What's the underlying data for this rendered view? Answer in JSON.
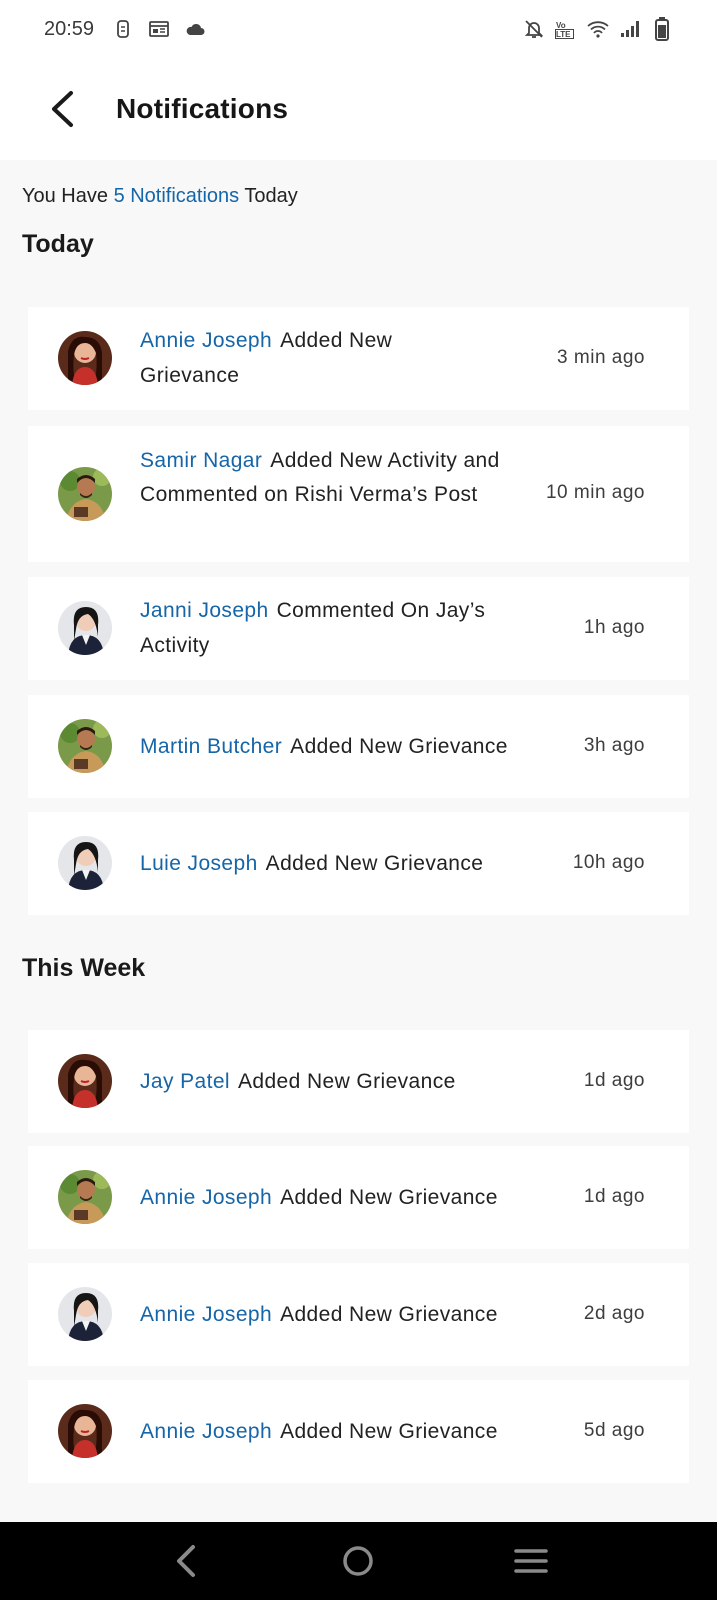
{
  "status_bar": {
    "time": "20:59",
    "icons_left": [
      "sim-icon",
      "calendar-icon",
      "cloud-icon"
    ],
    "icons_right": [
      "bell-off-icon",
      "volte-icon",
      "wifi-icon",
      "signal-icon",
      "battery-icon"
    ],
    "volte_label": "Vo LTE"
  },
  "header": {
    "title": "Notifications"
  },
  "summary": {
    "prefix": "You Have ",
    "count_text": "5 Notifications",
    "suffix": " Today"
  },
  "sections": {
    "today": {
      "title": "Today",
      "items": [
        {
          "name": "Annie Joseph",
          "action": "Added New Grievance",
          "time": "3 min ago",
          "avatar": "red"
        },
        {
          "name": "Samir Nagar",
          "action": "Added New Activity and Commented on Rishi Verma’s Post",
          "time": "10 min ago",
          "avatar": "green"
        },
        {
          "name": "Janni Joseph",
          "action": "Commented On Jay’s Activity",
          "time": "1h ago",
          "avatar": "navy"
        },
        {
          "name": "Martin Butcher",
          "action": "Added New Grievance",
          "time": "3h ago",
          "avatar": "green"
        },
        {
          "name": "Luie Joseph",
          "action": "Added New Grievance",
          "time": "10h ago",
          "avatar": "navy"
        }
      ]
    },
    "this_week": {
      "title": "This Week",
      "items": [
        {
          "name": "Jay Patel",
          "action": "Added New Grievance",
          "time": "1d ago",
          "avatar": "red"
        },
        {
          "name": "Annie Joseph",
          "action": "Added New Grievance",
          "time": "1d ago",
          "avatar": "green"
        },
        {
          "name": "Annie Joseph",
          "action": "Added New Grievance",
          "time": "2d ago",
          "avatar": "navy"
        },
        {
          "name": "Annie Joseph",
          "action": "Added New Grievance",
          "time": "5d ago",
          "avatar": "red"
        }
      ]
    }
  },
  "nav_bar": {
    "buttons": [
      "back-nav-icon",
      "home-nav-icon",
      "menu-nav-icon"
    ]
  },
  "colors": {
    "accent": "#1565a8",
    "background": "#f8f8f8",
    "card": "#ffffff"
  }
}
